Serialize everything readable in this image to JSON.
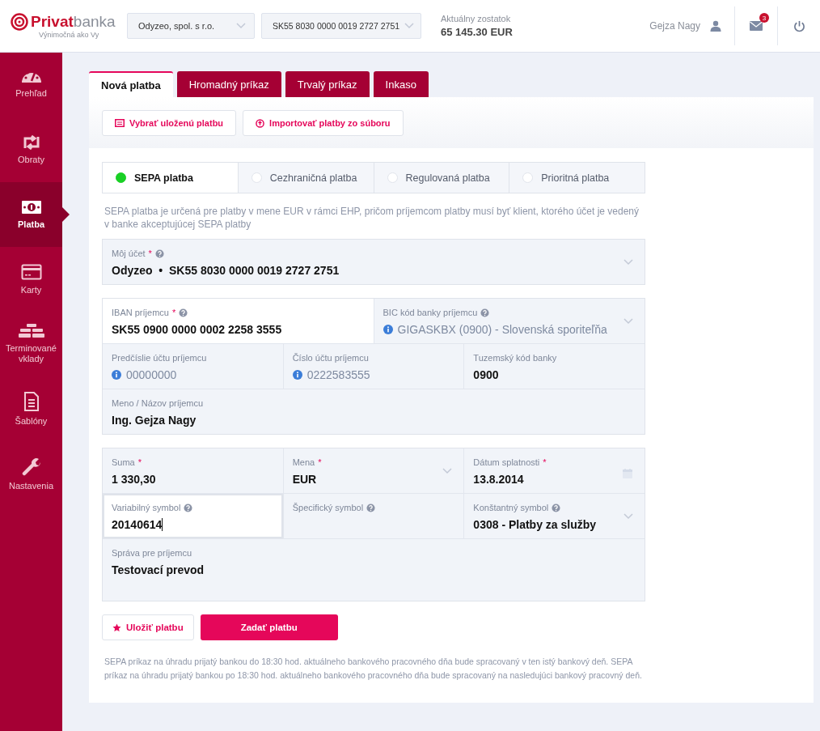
{
  "header": {
    "logo": {
      "name": "**Privat**banka",
      "tagline": "Výnimočná ako Vy"
    },
    "selects": [
      {
        "value": "Odyzeo, spol. s r.o."
      },
      {
        "value": "SK55 8030 0000 0019 2727 2751"
      }
    ],
    "balance": {
      "label": "Aktuálny zostatok",
      "value": "65 145.30 EUR"
    },
    "user": {
      "name": "Gejza Nagy"
    },
    "messages": {
      "badge": "3"
    }
  },
  "sidebar": {
    "items": [
      {
        "label": "Prehľad",
        "selected": false
      },
      {
        "label": "Obraty",
        "selected": false
      },
      {
        "label": "Platba",
        "selected": true
      },
      {
        "label": "Karty",
        "selected": false
      },
      {
        "label": "Terminované vklady",
        "selected": false
      },
      {
        "label": "Šablóny",
        "selected": false
      },
      {
        "label": "Nastavenia",
        "selected": false
      }
    ]
  },
  "tabs": [
    {
      "label": "Nová platba",
      "selected": true
    },
    {
      "label": "Hromadný príkaz",
      "selected": false
    },
    {
      "label": "Trvalý príkaz",
      "selected": false
    },
    {
      "label": "Inkaso",
      "selected": false
    }
  ],
  "toolbar": [
    {
      "label": "Vybrať uloženú platbu"
    },
    {
      "label": "Importovať platby zo súboru"
    }
  ],
  "payment_types": [
    {
      "label": "SEPA platba",
      "selected": true
    },
    {
      "label": "Cezhraničná platba",
      "selected": false
    },
    {
      "label": "Regulovaná platba",
      "selected": false
    },
    {
      "label": "Prioritná platba",
      "selected": false
    }
  ],
  "description": "SEPA platba je určená pre platby v mene EUR v rámci EHP, pričom príjemcom platby musí byť klient, ktorého účet je vedený v banke akceptujúcej SEPA platby",
  "groups": [
    {
      "rows": [
        {
          "fields": [
            {
              "label": "Môj účet",
              "required_mark": "*",
              "help": true,
              "value": "Odyzeo  •  SK55 8030 0000 0019 2727 2751",
              "kind": "select",
              "info": false,
              "active": false,
              "focused": false
            }
          ]
        }
      ]
    },
    {
      "rows": [
        {
          "fields": [
            {
              "label": "IBAN príjemcu",
              "required_mark": "*",
              "help": true,
              "value": "SK55 0900 0000 0002 2258 3555",
              "kind": "text",
              "info": false,
              "active": true,
              "focused": false
            },
            {
              "label": "BIC kód banky príjemcu",
              "help": true,
              "value": "GIGASKBX (0900) - Slovenská sporiteľňa",
              "kind": "select",
              "info": true,
              "active": false,
              "focused": false
            }
          ]
        },
        {
          "fields": [
            {
              "label": "Predčíslie účtu príjemcu",
              "help": false,
              "value": "00000000",
              "kind": "text",
              "info": true,
              "active": false,
              "focused": false
            },
            {
              "label": "Číslo účtu príjemcu",
              "help": false,
              "value": "0222583555",
              "kind": "text",
              "info": true,
              "active": false,
              "focused": false
            },
            {
              "label": "Tuzemský kód banky",
              "help": false,
              "value": "0900",
              "kind": "text",
              "info": false,
              "active": false,
              "focused": false
            }
          ]
        },
        {
          "fields": [
            {
              "label": "Meno / Názov príjemcu",
              "help": false,
              "value": "Ing. Gejza Nagy",
              "kind": "text",
              "info": false,
              "active": false,
              "focused": false
            }
          ]
        }
      ]
    },
    {
      "rows": [
        {
          "fields": [
            {
              "label": "Suma",
              "required_mark": "*",
              "help": false,
              "value": "1 330,30",
              "kind": "text",
              "info": false,
              "active": false,
              "focused": false
            },
            {
              "label": "Mena",
              "required_mark": "*",
              "help": false,
              "value": "EUR",
              "kind": "select",
              "info": false,
              "active": false,
              "focused": false
            },
            {
              "label": "Dátum splatnosti",
              "required_mark": "*",
              "help": false,
              "value": "13.8.2014",
              "kind": "date",
              "info": false,
              "active": false,
              "focused": false
            }
          ]
        },
        {
          "fields": [
            {
              "label": "Variabilný symbol",
              "help": true,
              "value": "20140614",
              "kind": "text",
              "info": false,
              "active": true,
              "focused": true
            },
            {
              "label": "Špecifický symbol",
              "help": true,
              "kind": "text",
              "info": false,
              "active": false,
              "focused": false
            },
            {
              "label": "Konštantný symbol",
              "help": true,
              "value": "0308 - Platby za služby",
              "kind": "select",
              "info": false,
              "active": false,
              "focused": false
            }
          ]
        },
        {
          "fields": [
            {
              "label": "Správa pre príjemcu",
              "help": false,
              "value": "Testovací prevod",
              "kind": "textarea",
              "info": false,
              "active": false,
              "focused": false
            }
          ]
        }
      ]
    }
  ],
  "actions": [
    {
      "label": "Uložiť platbu",
      "kind": "secondary"
    },
    {
      "label": "Zadať platbu",
      "kind": "primary"
    }
  ],
  "footnote": "SEPA príkaz na úhradu prijatý bankou do 18:30 hod. aktuálneho bankového pracovného dňa bude spracovaný v ten istý bankový deň. SEPA príkaz na úhradu prijatý bankou po 18:30 hod. aktuálneho bankového pracovného dňa bude spracovaný na nasledujúci bankový pracovný deň."
}
